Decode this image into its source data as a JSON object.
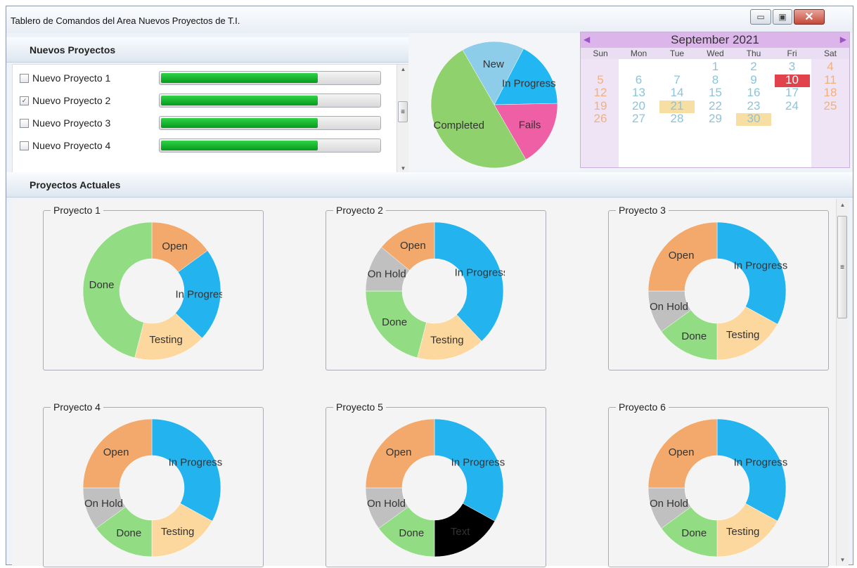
{
  "window": {
    "title": "Tablero de Comandos del Area Nuevos Proyectos de T.I."
  },
  "nuevos": {
    "heading": "Nuevos Proyectos",
    "items": [
      {
        "label": "Nuevo Proyecto 1",
        "checked": false,
        "progress": 0.72
      },
      {
        "label": "Nuevo Proyecto 2",
        "checked": true,
        "progress": 0.72
      },
      {
        "label": "Nuevo Proyecto 3",
        "checked": false,
        "progress": 0.72
      },
      {
        "label": "Nuevo Proyecto 4",
        "checked": false,
        "progress": 0.72
      }
    ]
  },
  "status_pie": {
    "slices": [
      {
        "label": "New",
        "value": 16,
        "color": "#8ecdea"
      },
      {
        "label": "In Progress",
        "value": 17,
        "color": "#22b6f2"
      },
      {
        "label": "Fails",
        "value": 17,
        "color": "#ef5fa6"
      },
      {
        "label": "Completed",
        "value": 50,
        "color": "#8fd16c"
      }
    ]
  },
  "calendar": {
    "month_label": "September 2021",
    "weekdays": [
      "Sun",
      "Mon",
      "Tue",
      "Wed",
      "Thu",
      "Fri",
      "Sat"
    ],
    "first_weekday": 3,
    "days_in_month": 30,
    "today": 10,
    "highlighted": [
      21,
      30
    ],
    "today_color": "#e2424b",
    "highlight_color": "#f7dea3"
  },
  "actuales": {
    "heading": "Proyectos Actuales",
    "colors": {
      "Open": "#f2a96b",
      "In Progress": "#23b4ef",
      "Testing": "#fcd79e",
      "Done": "#92dd84",
      "On Hold": "#c0c0c0"
    },
    "projects": [
      {
        "title": "Proyecto 1",
        "segments": [
          {
            "label": "Open",
            "value": 15
          },
          {
            "label": "In Progress",
            "value": 22
          },
          {
            "label": "Testing",
            "value": 17
          },
          {
            "label": "Done",
            "value": 46
          }
        ]
      },
      {
        "title": "Proyecto 2",
        "segments": [
          {
            "label": "In Progress",
            "value": 38
          },
          {
            "label": "Testing",
            "value": 16
          },
          {
            "label": "Done",
            "value": 21
          },
          {
            "label": "On Hold",
            "value": 11
          },
          {
            "label": "Open",
            "value": 14
          }
        ]
      },
      {
        "title": "Proyecto 3",
        "segments": [
          {
            "label": "In Progress",
            "value": 33
          },
          {
            "label": "Testing",
            "value": 17
          },
          {
            "label": "Done",
            "value": 15
          },
          {
            "label": "On Hold",
            "value": 10
          },
          {
            "label": "Open",
            "value": 25
          }
        ]
      },
      {
        "title": "Proyecto 4",
        "segments": [
          {
            "label": "In Progress",
            "value": 33
          },
          {
            "label": "Testing",
            "value": 17
          },
          {
            "label": "Done",
            "value": 15
          },
          {
            "label": "On Hold",
            "value": 10
          },
          {
            "label": "Open",
            "value": 25
          }
        ]
      },
      {
        "title": "Proyecto 5",
        "segments": [
          {
            "label": "In Progress",
            "value": 33
          },
          {
            "label": "Text",
            "value": 17
          },
          {
            "label": "Done",
            "value": 15
          },
          {
            "label": "On Hold",
            "value": 10
          },
          {
            "label": "Open",
            "value": 25
          }
        ]
      },
      {
        "title": "Proyecto 6",
        "segments": [
          {
            "label": "In Progress",
            "value": 33
          },
          {
            "label": "Testing",
            "value": 17
          },
          {
            "label": "Done",
            "value": 15
          },
          {
            "label": "On Hold",
            "value": 10
          },
          {
            "label": "Open",
            "value": 25
          }
        ]
      }
    ]
  },
  "chart_data": [
    {
      "type": "pie",
      "categories": [
        "New",
        "In Progress",
        "Fails",
        "Completed"
      ],
      "values": [
        16,
        17,
        17,
        50
      ]
    },
    {
      "type": "pie",
      "title": "Proyecto 1",
      "categories": [
        "Open",
        "In Progress",
        "Testing",
        "Done"
      ],
      "values": [
        15,
        22,
        17,
        46
      ]
    },
    {
      "type": "pie",
      "title": "Proyecto 2",
      "categories": [
        "In Progress",
        "Testing",
        "Done",
        "On Hold",
        "Open"
      ],
      "values": [
        38,
        16,
        21,
        11,
        14
      ]
    },
    {
      "type": "pie",
      "title": "Proyecto 3",
      "categories": [
        "In Progress",
        "Testing",
        "Done",
        "On Hold",
        "Open"
      ],
      "values": [
        33,
        17,
        15,
        10,
        25
      ]
    },
    {
      "type": "pie",
      "title": "Proyecto 4",
      "categories": [
        "In Progress",
        "Testing",
        "Done",
        "On Hold",
        "Open"
      ],
      "values": [
        33,
        17,
        15,
        10,
        25
      ]
    },
    {
      "type": "pie",
      "title": "Proyecto 5",
      "categories": [
        "In Progress",
        "Text",
        "Done",
        "On Hold",
        "Open"
      ],
      "values": [
        33,
        17,
        15,
        10,
        25
      ]
    },
    {
      "type": "pie",
      "title": "Proyecto 6",
      "categories": [
        "In Progress",
        "Testing",
        "Done",
        "On Hold",
        "Open"
      ],
      "values": [
        33,
        17,
        15,
        10,
        25
      ]
    }
  ]
}
